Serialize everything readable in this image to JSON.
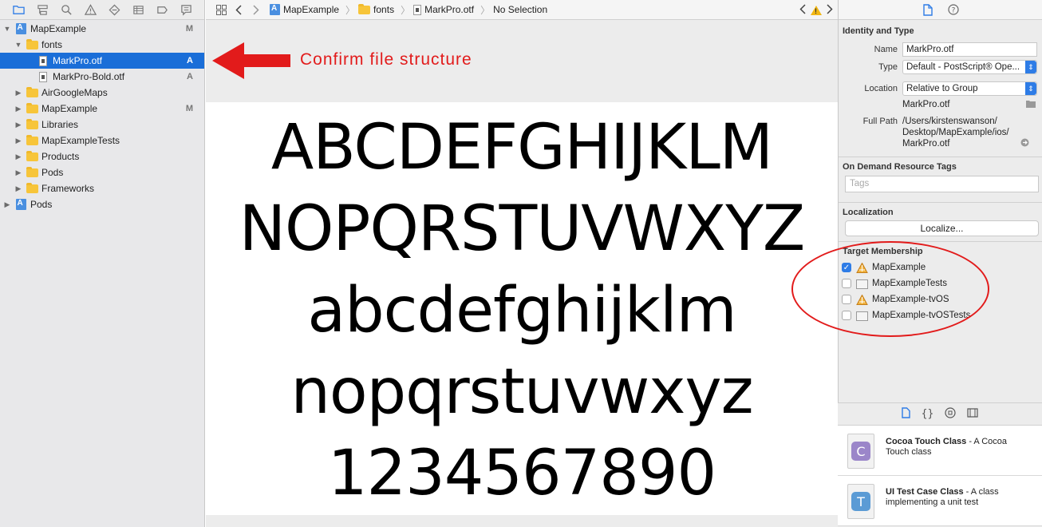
{
  "navigator": {
    "toolbar_icons": [
      "folder-icon",
      "hierarchy-icon",
      "search-icon",
      "warning-icon",
      "test-icon",
      "debug-icon",
      "breakpoint-icon",
      "report-icon"
    ],
    "tree": [
      {
        "label": "MapExample",
        "badge": "M",
        "icon": "project-icon",
        "disclosure": "▼",
        "indent": 0
      },
      {
        "label": "fonts",
        "badge": "",
        "icon": "folder-icon",
        "disclosure": "▼",
        "indent": 1
      },
      {
        "label": "MarkPro.otf",
        "badge": "A",
        "icon": "file-icon",
        "disclosure": "",
        "indent": 2,
        "selected": true
      },
      {
        "label": "MarkPro-Bold.otf",
        "badge": "A",
        "icon": "file-icon",
        "disclosure": "",
        "indent": 2
      },
      {
        "label": "AirGoogleMaps",
        "badge": "",
        "icon": "folder-icon",
        "disclosure": "▶",
        "indent": 1
      },
      {
        "label": "MapExample",
        "badge": "M",
        "icon": "folder-icon",
        "disclosure": "▶",
        "indent": 1
      },
      {
        "label": "Libraries",
        "badge": "",
        "icon": "folder-icon",
        "disclosure": "▶",
        "indent": 1
      },
      {
        "label": "MapExampleTests",
        "badge": "",
        "icon": "folder-icon",
        "disclosure": "▶",
        "indent": 1
      },
      {
        "label": "Products",
        "badge": "",
        "icon": "folder-icon",
        "disclosure": "▶",
        "indent": 1
      },
      {
        "label": "Pods",
        "badge": "",
        "icon": "folder-icon",
        "disclosure": "▶",
        "indent": 1
      },
      {
        "label": "Frameworks",
        "badge": "",
        "icon": "folder-icon",
        "disclosure": "▶",
        "indent": 1
      },
      {
        "label": "Pods",
        "badge": "",
        "icon": "project-icon",
        "disclosure": "▶",
        "indent": 0
      }
    ]
  },
  "jump_bar": {
    "crumbs": [
      "MapExample",
      "fonts",
      "MarkPro.otf",
      "No Selection"
    ]
  },
  "annotation": {
    "text": "Confirm file structure",
    "color": "#e21b1b"
  },
  "preview": {
    "lines": [
      "ABCDEFGHIJKLM",
      "NOPQRSTUVWXYZ",
      "abcdefghijklm",
      "nopqrstuvwxyz",
      "1234567890"
    ]
  },
  "inspector": {
    "identity": {
      "header": "Identity and Type",
      "name_label": "Name",
      "name_value": "MarkPro.otf",
      "type_label": "Type",
      "type_value": "Default - PostScript® Ope...",
      "location_label": "Location",
      "location_value": "Relative to Group",
      "location_file": "MarkPro.otf",
      "fullpath_label": "Full Path",
      "fullpath_lines": [
        "/Users/kirstenswanson/",
        "Desktop/MapExample/ios/",
        "MarkPro.otf"
      ]
    },
    "on_demand": {
      "header": "On Demand Resource Tags",
      "tags_placeholder": "Tags"
    },
    "localization": {
      "header": "Localization",
      "button": "Localize..."
    },
    "target_membership": {
      "header": "Target Membership",
      "targets": [
        {
          "label": "MapExample",
          "checked": true,
          "icon": "app-target-icon"
        },
        {
          "label": "MapExampleTests",
          "checked": false,
          "icon": "bundle-target-icon"
        },
        {
          "label": "MapExample-tvOS",
          "checked": false,
          "icon": "app-target-icon"
        },
        {
          "label": "MapExample-tvOSTests",
          "checked": false,
          "icon": "bundle-target-icon"
        }
      ]
    }
  },
  "library": {
    "items": [
      {
        "title": "Cocoa Touch Class",
        "desc": " - A Cocoa Touch class",
        "letter": "C",
        "color": "#9b86c9"
      },
      {
        "title": "UI Test Case Class",
        "desc": " - A class implementing a unit test",
        "letter": "T",
        "color": "#5b9bd5"
      }
    ]
  }
}
